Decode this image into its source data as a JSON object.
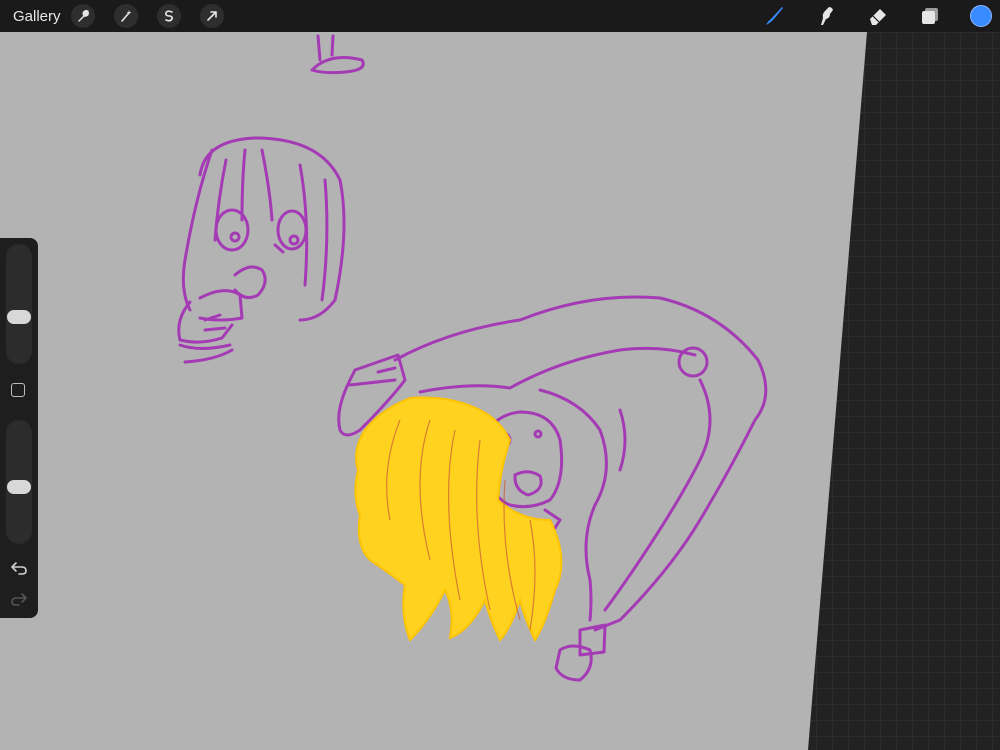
{
  "topbar": {
    "gallery_label": "Gallery",
    "left_tools": [
      "wrench-icon",
      "magic-wand-icon",
      "selection-icon",
      "transform-arrow-icon"
    ],
    "right_tools": [
      "brush-icon",
      "smudge-icon",
      "eraser-icon",
      "layers-icon"
    ],
    "active_tool": "brush-icon",
    "brush_color": "#3a8bff",
    "current_color": "#3a8bff"
  },
  "sidebar": {
    "brush_size_level": 0.58,
    "opacity_level": 0.54,
    "icons": [
      "modify-square-icon",
      "undo-icon",
      "redo-icon"
    ]
  },
  "canvas": {
    "background_color": "#b3b3b3",
    "workspace_color": "#222222",
    "line_color": "#a43bb5",
    "hair_color": "#ffd21f"
  }
}
